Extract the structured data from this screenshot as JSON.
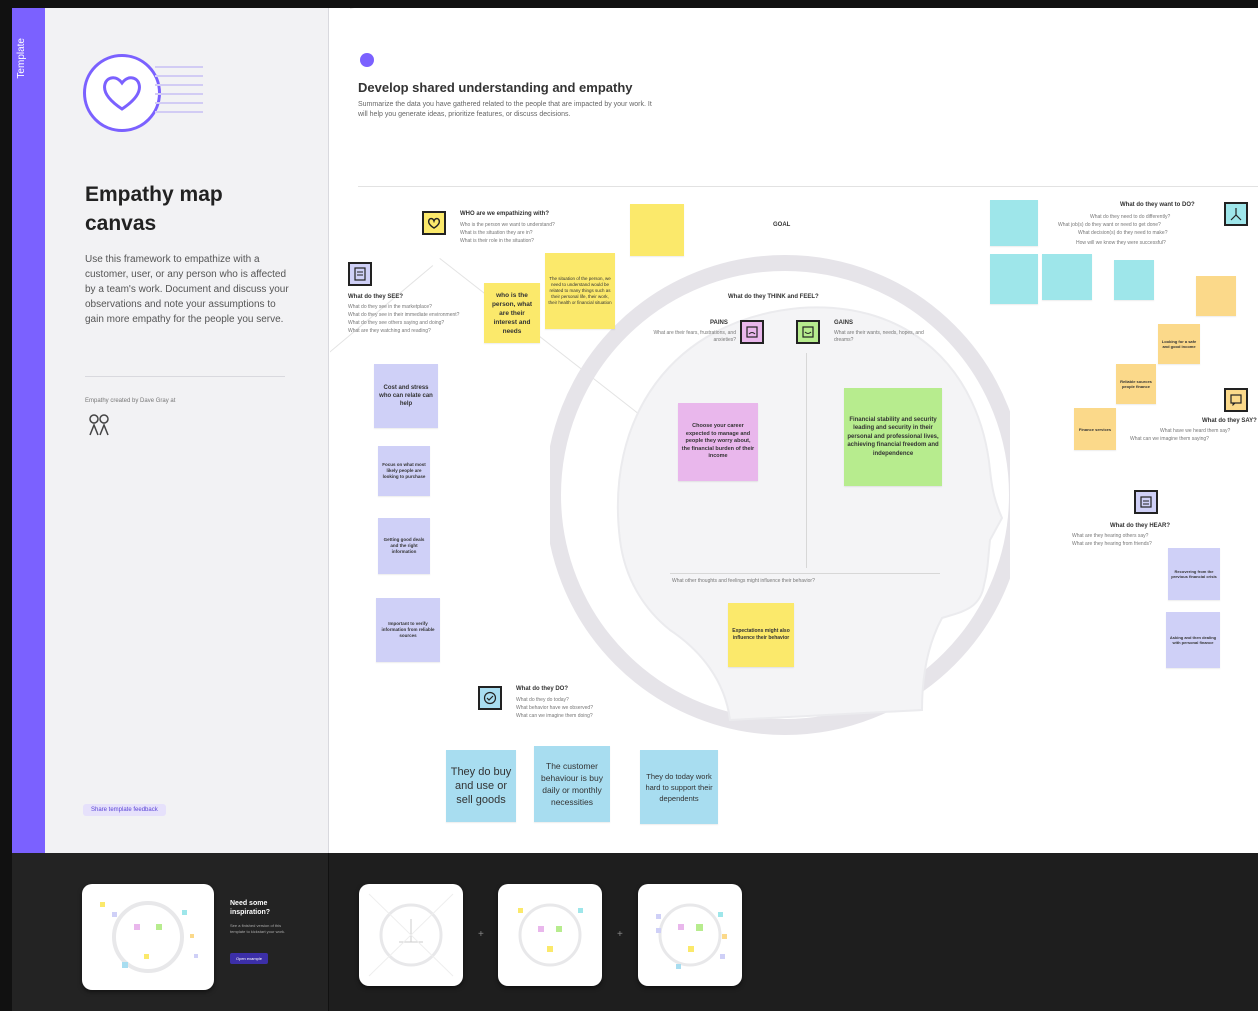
{
  "sidebar": {
    "tab_label": "Template",
    "title_line1": "Empathy map",
    "title_line2": "canvas",
    "description": "Use this framework to empathize with a customer, user, or any person who is affected by a team's work. Document and discuss your observations and note your assumptions to gain more empathy for the people you serve.",
    "credit": "Empathy created by Dave Gray at",
    "feedback_label": "Share template feedback"
  },
  "canvas": {
    "title": "Develop shared understanding and empathy",
    "subtitle": "Summarize the data you have gathered related to the people that are impacted by your work. It will help you generate ideas, prioritize features, or discuss decisions.",
    "who": {
      "heading": "WHO are we empathizing with?",
      "q1": "Who is the person we want to understand?",
      "q2": "What is the situation they are in?",
      "q3": "What is their role in the situation?"
    },
    "goal_label": "GOAL",
    "think_feel": {
      "heading": "What do they THINK and FEEL?",
      "pains_label": "PAINS",
      "pains_q": "What are their fears, frustrations, and anxieties?",
      "gains_label": "GAINS",
      "gains_q": "What are their wants, needs, hopes, and dreams?",
      "other_q": "What other thoughts and feelings might influence their behavior?"
    },
    "see": {
      "heading": "What do they SEE?",
      "q1": "What do they see in the marketplace?",
      "q2": "What do they see in their immediate environment?",
      "q3": "What do they see others saying and doing?",
      "q4": "What are they watching and reading?"
    },
    "say": {
      "heading": "What do they SAY?",
      "q1": "What have we heard them say?",
      "q2": "What can we imagine them saying?"
    },
    "do": {
      "heading": "What do they DO?",
      "q1": "What do they do today?",
      "q2": "What behavior have we observed?",
      "q3": "What can we imagine them doing?"
    },
    "hear": {
      "heading": "What do they HEAR?",
      "q1": "What are they hearing others say?",
      "q2": "What are they hearing from friends?",
      "q3": "What are they hearing from colleagues?",
      "q4": "What are they hearing second-hand?"
    },
    "want": {
      "heading": "What do they want to DO?",
      "q1": "What do they need to do differently?",
      "q2": "What job(s) do they want or need to get done?",
      "q3": "What decision(s) do they need to make?",
      "q4": "How will we know they were successful?"
    },
    "stickies": {
      "who1": "who is the person, what are their interest and needs",
      "who2": "The situation of the person, we need to understand would be related to many things such as their personal life, their work, their health or financial situation",
      "see1": "Cost and stress who can relate can help",
      "see2": "Focus on what most likely people are looking to purchase",
      "see3": "Getting good deals and the right information",
      "see4": "Important to verify information from reliable sources",
      "pain1": "Choose your career expected to manage and people they worry about, the financial burden of their income",
      "gain1": "Financial stability and security leading and security in their personal and professional lives, achieving financial freedom and independence",
      "other1": "Expectations might also influence their behavior",
      "do1": "They do buy and use or sell goods",
      "do2": "The customer behaviour is buy daily or monthly necessities",
      "do3": "They do today work hard to support their dependents",
      "hear1": "Recovering from the previous financial crisis",
      "hear2": "Asking and then dealing with personal finance",
      "say1": "Reliable sources people finance",
      "say2": "Finance services",
      "say3": "Looking for a safe and good income"
    }
  },
  "bottom": {
    "inspiration_title": "Need some inspiration?",
    "inspiration_desc": "See a finished version of this template to kickstart your work.",
    "inspiration_button": "Open example"
  },
  "colors": {
    "accent": "#7b61ff",
    "yellow": "#fbe96b",
    "blue": "#cfd0f7",
    "pink": "#e9b7ec",
    "green": "#b7ec8e",
    "cyan": "#9ee6ea",
    "orange": "#fbd98a",
    "light_blue": "#a8ddf0"
  }
}
